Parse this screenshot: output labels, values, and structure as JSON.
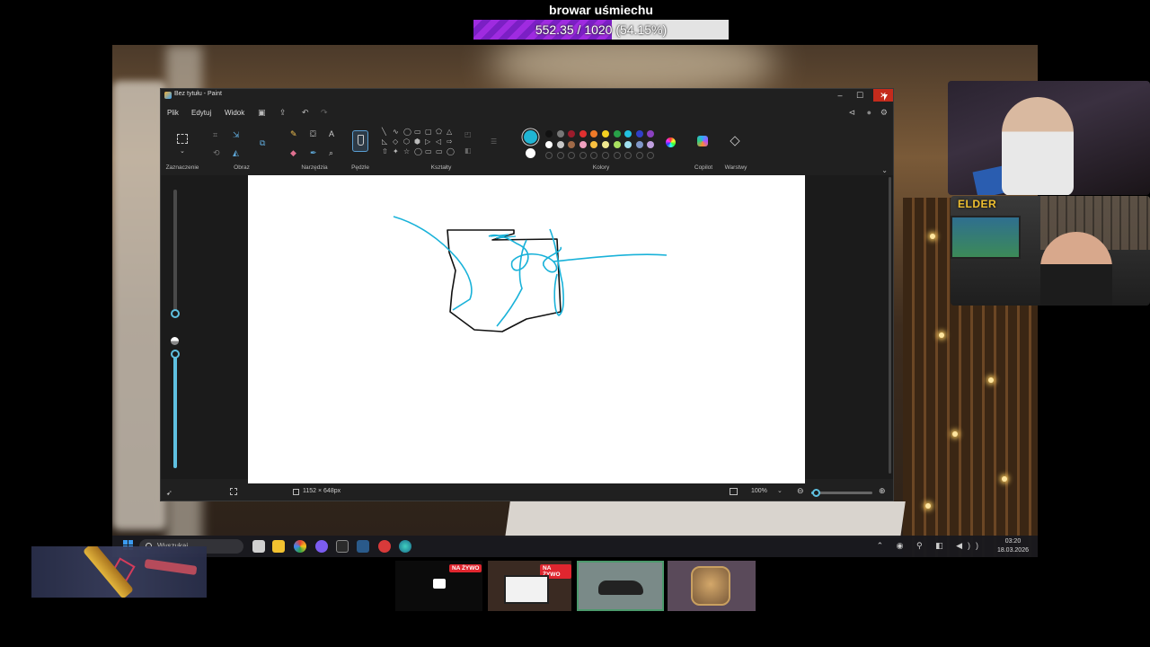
{
  "overlay": {
    "goal_title": "browar uśmiechu",
    "goal_text": "552.35 / 1020 (54.15%)",
    "goal_fraction": 0.5415,
    "goal_color": "#9f2be0"
  },
  "paint": {
    "title": "Bez tytułu - Paint",
    "window_controls": {
      "minimize": "–",
      "maximize": "☐",
      "close": "✕"
    },
    "menu": {
      "file": "Plik",
      "edit": "Edytuj",
      "view": "Widok"
    },
    "ribbon_groups": {
      "selection": "Zaznaczenie",
      "image": "Obraz",
      "tools": "Narzędzia",
      "brushes": "Pędzle",
      "shapes": "Kształty",
      "colors": "Kolory",
      "copilot": "Copilot",
      "layers": "Warstwy"
    },
    "palette": [
      "#111111",
      "#777777",
      "#9b1c2c",
      "#e03030",
      "#f07a28",
      "#f4d020",
      "#28a048",
      "#22c0e0",
      "#3040c8",
      "#8a40c0",
      "#ffffff",
      "#c8c8c8",
      "#a06a48",
      "#f0a0c0",
      "#f8c040",
      "#f0e890",
      "#a8e060",
      "#a0e0f0",
      "#8098c8",
      "#c0a0e0"
    ],
    "primary_color": "#20b5d4",
    "status": {
      "canvas_size": "1152 × 648px",
      "zoom": "100%",
      "zoom_fraction": 0.08
    }
  },
  "taskbar": {
    "search_placeholder": "Wyszukaj",
    "clock_time": "03:20",
    "clock_date": "18.03.2026"
  },
  "cam2": {
    "logo": "ELDER"
  },
  "tiles": {
    "live_label": "NA ŻYWO"
  }
}
